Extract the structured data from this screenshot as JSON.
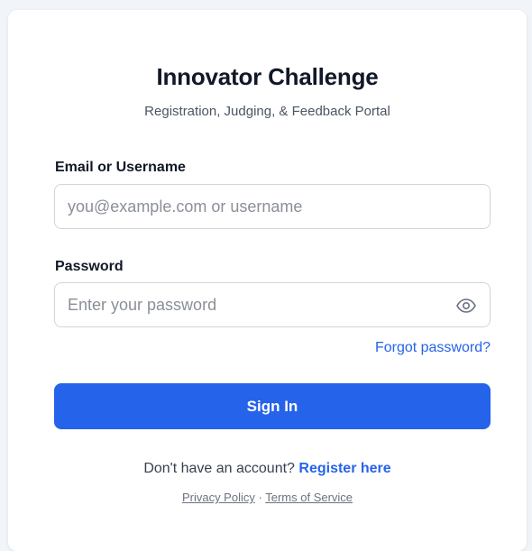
{
  "header": {
    "title": "Innovator Challenge",
    "subtitle": "Registration, Judging, & Feedback Portal"
  },
  "form": {
    "email": {
      "label": "Email or Username",
      "placeholder": "you@example.com or username",
      "value": ""
    },
    "password": {
      "label": "Password",
      "placeholder": "Enter your password",
      "value": "",
      "toggle_icon": "eye-icon"
    },
    "forgot_label": "Forgot password?",
    "submit_label": "Sign In"
  },
  "register": {
    "prompt": "Don't have an account?",
    "link_label": "Register here"
  },
  "footer": {
    "privacy_label": "Privacy Policy",
    "separator": "·",
    "terms_label": "Terms of Service"
  },
  "colors": {
    "primary": "#2563eb",
    "background": "#f1f4f8",
    "card": "#ffffff",
    "heading": "#111827",
    "muted": "#6b7280"
  }
}
